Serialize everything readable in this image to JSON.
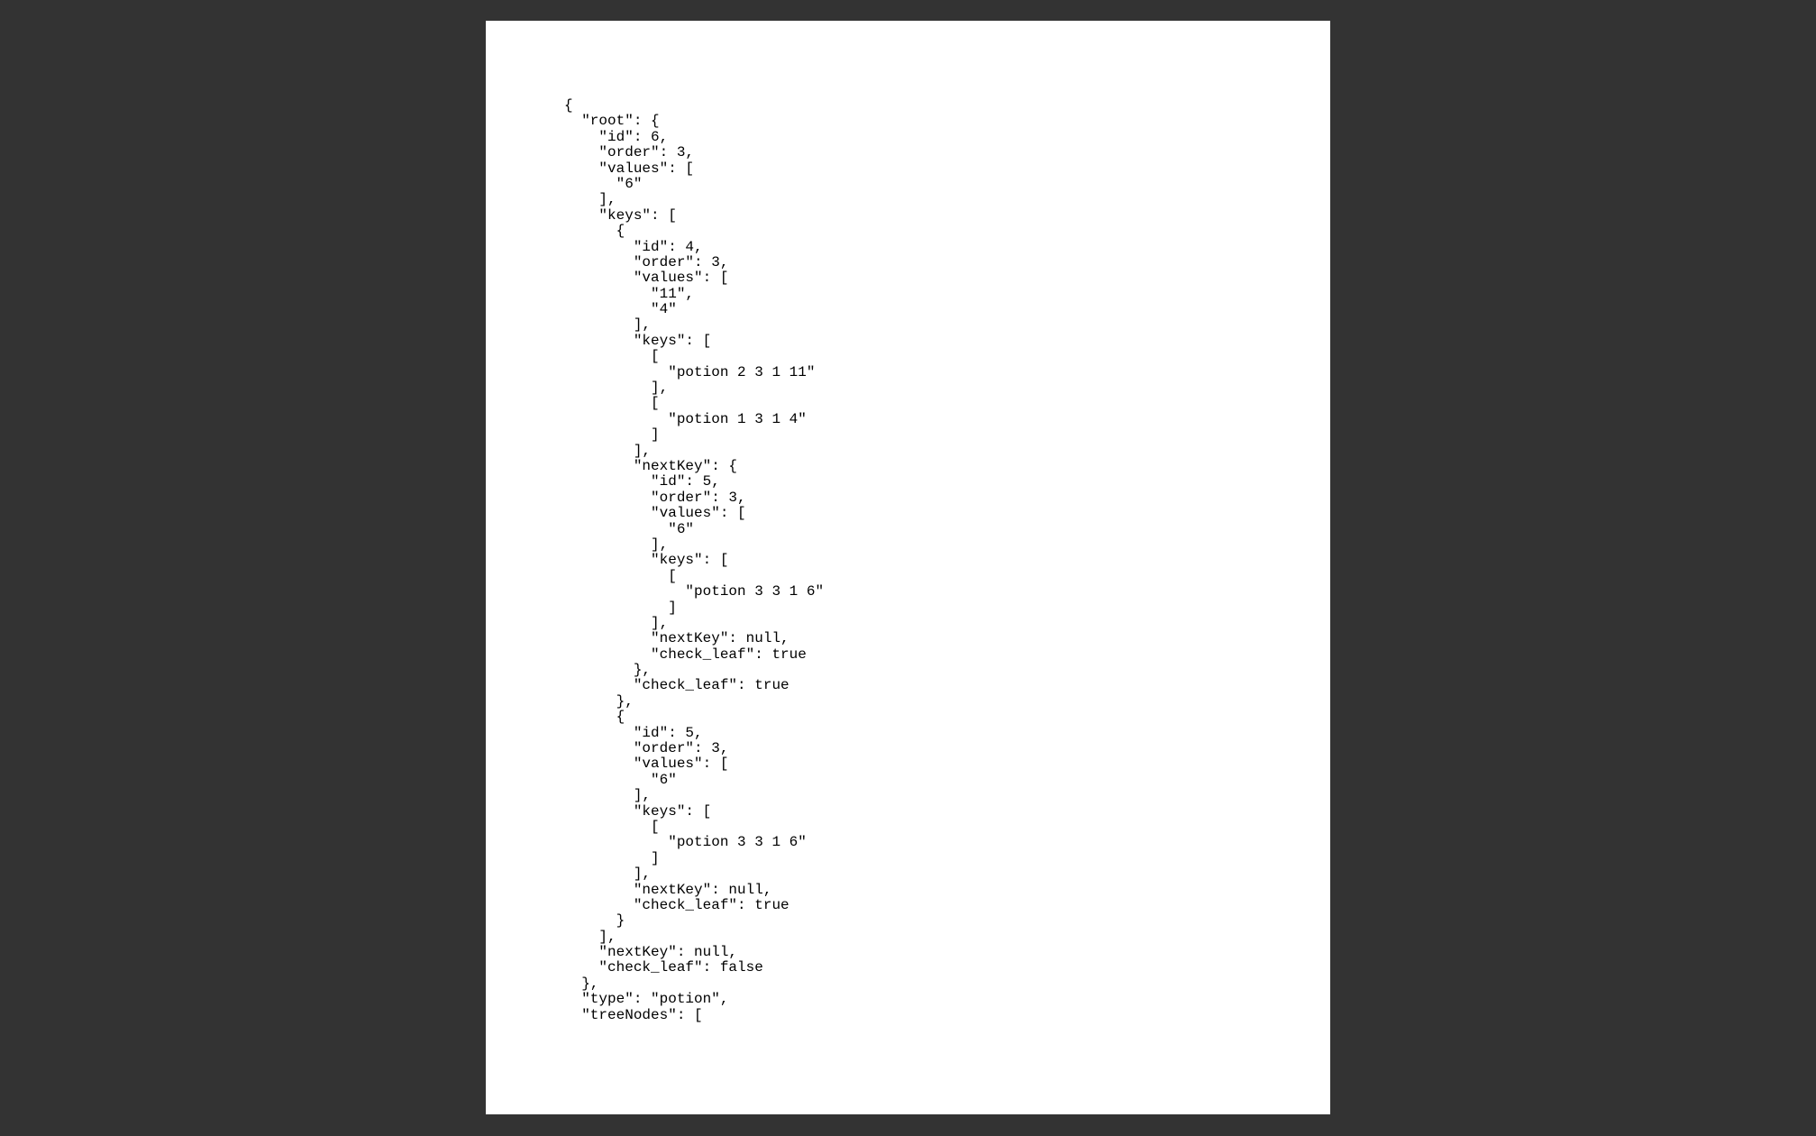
{
  "document": {
    "lines": [
      "{",
      "  \"root\": {",
      "    \"id\": 6,",
      "    \"order\": 3,",
      "    \"values\": [",
      "      \"6\"",
      "    ],",
      "    \"keys\": [",
      "      {",
      "        \"id\": 4,",
      "        \"order\": 3,",
      "        \"values\": [",
      "          \"11\",",
      "          \"4\"",
      "        ],",
      "        \"keys\": [",
      "          [",
      "            \"potion 2 3 1 11\"",
      "          ],",
      "          [",
      "            \"potion 1 3 1 4\"",
      "          ]",
      "        ],",
      "        \"nextKey\": {",
      "          \"id\": 5,",
      "          \"order\": 3,",
      "          \"values\": [",
      "            \"6\"",
      "          ],",
      "          \"keys\": [",
      "            [",
      "              \"potion 3 3 1 6\"",
      "            ]",
      "          ],",
      "          \"nextKey\": null,",
      "          \"check_leaf\": true",
      "        },",
      "        \"check_leaf\": true",
      "      },",
      "      {",
      "        \"id\": 5,",
      "        \"order\": 3,",
      "        \"values\": [",
      "          \"6\"",
      "        ],",
      "        \"keys\": [",
      "          [",
      "            \"potion 3 3 1 6\"",
      "          ]",
      "        ],",
      "        \"nextKey\": null,",
      "        \"check_leaf\": true",
      "      }",
      "    ],",
      "    \"nextKey\": null,",
      "    \"check_leaf\": false",
      "  },",
      "  \"type\": \"potion\",",
      "  \"treeNodes\": ["
    ]
  }
}
